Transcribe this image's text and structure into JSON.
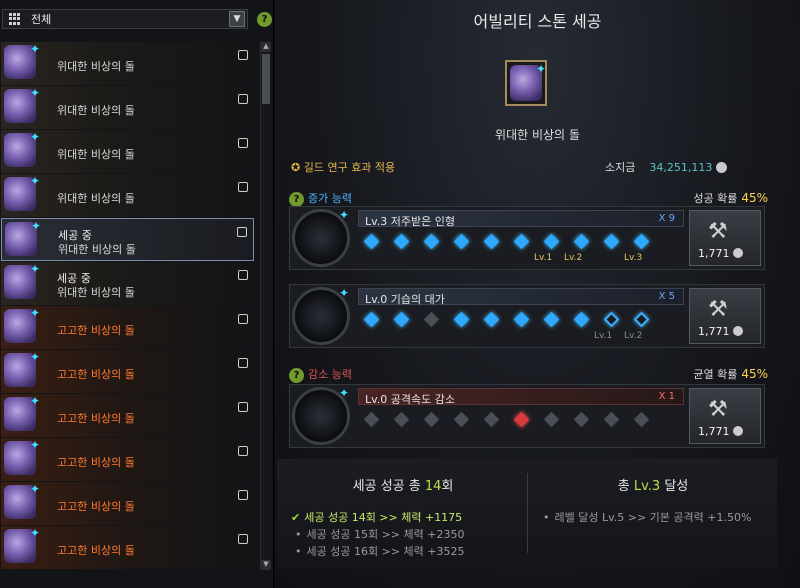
{
  "filter": {
    "label": "전체",
    "icon": "grid-icon"
  },
  "items": [
    {
      "status": "",
      "name": "위대한 비상의 돌",
      "color": "#dadada",
      "selected": false
    },
    {
      "status": "",
      "name": "위대한 비상의 돌",
      "color": "#dadada",
      "selected": false
    },
    {
      "status": "",
      "name": "위대한 비상의 돌",
      "color": "#dadada",
      "selected": false
    },
    {
      "status": "",
      "name": "위대한 비상의 돌",
      "color": "#dadada",
      "selected": false
    },
    {
      "status": "세공 중",
      "name": "위대한 비상의 돌",
      "color": "#dadada",
      "selected": true
    },
    {
      "status": "세공 중",
      "name": "위대한 비상의 돌",
      "color": "#dadada",
      "selected": false
    },
    {
      "status": "",
      "name": "고고한 비상의 돌",
      "color": "#ff7a2e",
      "selected": false
    },
    {
      "status": "",
      "name": "고고한 비상의 돌",
      "color": "#ff7a2e",
      "selected": false
    },
    {
      "status": "",
      "name": "고고한 비상의 돌",
      "color": "#ff7a2e",
      "selected": false
    },
    {
      "status": "",
      "name": "고고한 비상의 돌",
      "color": "#ff7a2e",
      "selected": false
    },
    {
      "status": "",
      "name": "고고한 비상의 돌",
      "color": "#ff7a2e",
      "selected": false
    },
    {
      "status": "",
      "name": "고고한 비상의 돌",
      "color": "#ff7a2e",
      "selected": false
    }
  ],
  "title": "어빌리티 스톤 세공",
  "stone_name": "위대한 비상의 돌",
  "guild": "길드 연구 효과 적용",
  "money": {
    "label": "소지금",
    "value": "34,251,113"
  },
  "increase": {
    "label": "증가 능력",
    "rate_label": "성공 확률",
    "rate": "45%"
  },
  "decrease": {
    "label": "감소 능력",
    "rate_label": "균열 확률",
    "rate": "45%"
  },
  "rows": [
    {
      "title": "Lv.3 저주받은 인형",
      "mult": "X 9",
      "cost": "1,771",
      "slots": [
        "f",
        "f",
        "f",
        "f",
        "f",
        "f",
        "f",
        "f",
        "f",
        "f"
      ],
      "lvs": [
        "Lv.1",
        "Lv.2",
        "Lv.3"
      ]
    },
    {
      "title": "Lv.0 기습의 대가",
      "mult": "X 5",
      "cost": "1,771",
      "slots": [
        "f",
        "f",
        "e",
        "f",
        "f",
        "f",
        "f",
        "f",
        "o",
        "o"
      ],
      "lvs": [
        "Lv.1",
        "Lv.2"
      ]
    },
    {
      "title": "Lv.0 공격속도 감소",
      "mult": "X 1",
      "cost": "1,771",
      "slots": [
        "e",
        "e",
        "e",
        "e",
        "e",
        "r",
        "e",
        "e",
        "e",
        "e"
      ],
      "lvs": []
    }
  ],
  "success": {
    "prefix": "세공 성공 총 ",
    "count": "14",
    "suffix": "회"
  },
  "achieve": {
    "prefix": "총 ",
    "level": "Lv.3",
    "suffix": " 달성"
  },
  "rewards": [
    "세공 성공 14회 >> 체력 +1175",
    "세공 성공 15회 >> 체력 +2350",
    "세공 성공 16회 >> 체력 +3525"
  ],
  "level_reward": "레벨 달성 Lv.5 >> 기본 공격력 +1.50%",
  "colors": {
    "accent_gold": "#ffd44c",
    "blue": "#2fa8ff",
    "red": "#d83b3b",
    "green": "#b9e04a"
  }
}
